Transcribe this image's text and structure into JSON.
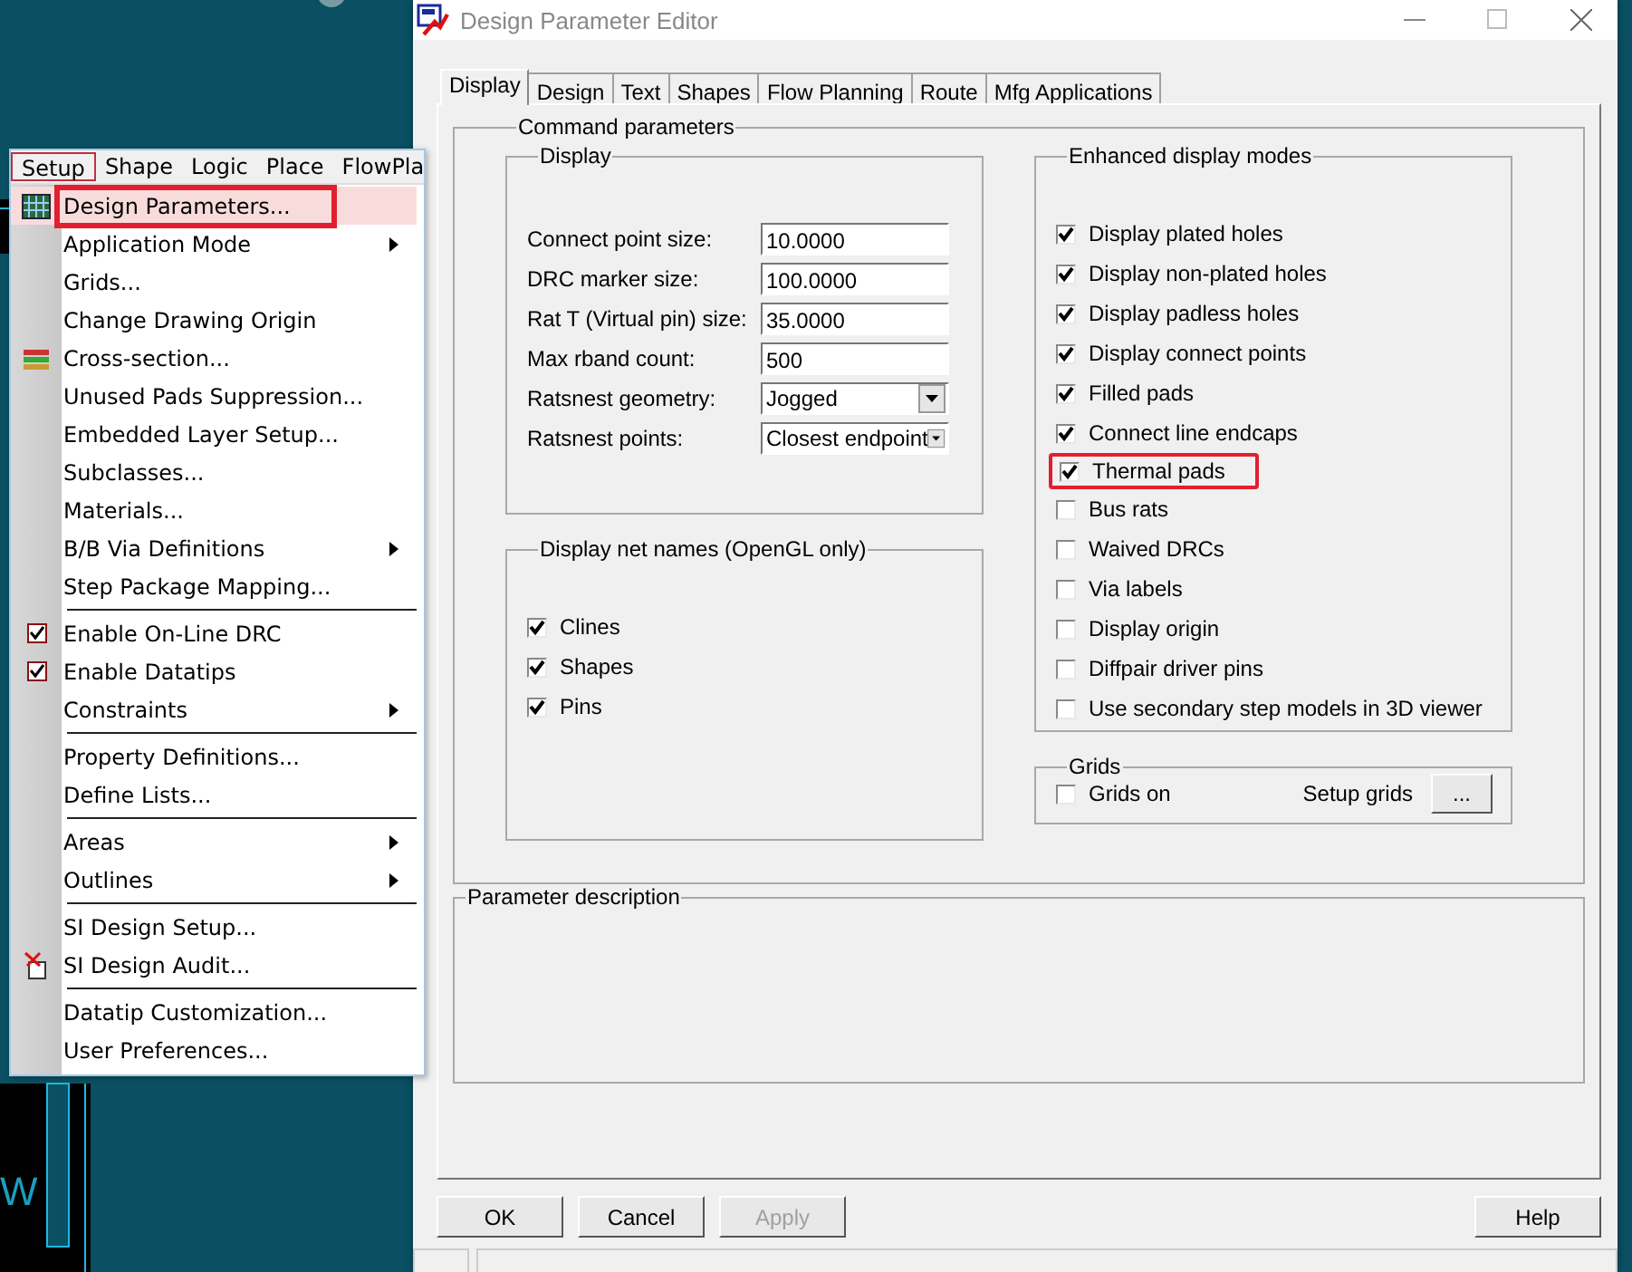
{
  "canvas": {
    "label": "W"
  },
  "menu": {
    "bar": [
      {
        "label": "Setup",
        "selected": true
      },
      {
        "label": "Shape",
        "selected": false
      },
      {
        "label": "Logic",
        "selected": false
      },
      {
        "label": "Place",
        "selected": false
      },
      {
        "label": "FlowPla",
        "selected": false
      }
    ],
    "items": [
      {
        "kind": "icon",
        "label": "Design Parameters...",
        "submenu": false,
        "highlighted": true,
        "annotated": true
      },
      {
        "kind": "plain",
        "label": "Application Mode",
        "submenu": true,
        "highlighted": false,
        "annotated": false
      },
      {
        "kind": "plain",
        "label": "Grids...",
        "submenu": false,
        "highlighted": false,
        "annotated": false
      },
      {
        "kind": "plain",
        "label": "Change Drawing Origin",
        "submenu": false,
        "highlighted": false,
        "annotated": false
      },
      {
        "kind": "icon",
        "label": "Cross-section...",
        "submenu": false,
        "highlighted": false,
        "annotated": false
      },
      {
        "kind": "plain",
        "label": "Unused Pads Suppression...",
        "submenu": false,
        "highlighted": false,
        "annotated": false
      },
      {
        "kind": "plain",
        "label": "Embedded Layer Setup...",
        "submenu": false,
        "highlighted": false,
        "annotated": false
      },
      {
        "kind": "plain",
        "label": "Subclasses...",
        "submenu": false,
        "highlighted": false,
        "annotated": false
      },
      {
        "kind": "plain",
        "label": "Materials...",
        "submenu": false,
        "highlighted": false,
        "annotated": false
      },
      {
        "kind": "plain",
        "label": "B/B Via Definitions",
        "submenu": true,
        "highlighted": false,
        "annotated": false
      },
      {
        "kind": "plain",
        "label": "Step Package Mapping...",
        "submenu": false,
        "highlighted": false,
        "annotated": false
      },
      {
        "kind": "separator"
      },
      {
        "kind": "check",
        "label": "Enable On-Line DRC",
        "checked": true,
        "submenu": false,
        "highlighted": false,
        "annotated": false
      },
      {
        "kind": "check",
        "label": "Enable Datatips",
        "checked": true,
        "submenu": false,
        "highlighted": false,
        "annotated": false
      },
      {
        "kind": "plain",
        "label": "Constraints",
        "submenu": true,
        "highlighted": false,
        "annotated": false
      },
      {
        "kind": "separator"
      },
      {
        "kind": "plain",
        "label": "Property Definitions...",
        "submenu": false,
        "highlighted": false,
        "annotated": false
      },
      {
        "kind": "plain",
        "label": "Define Lists...",
        "submenu": false,
        "highlighted": false,
        "annotated": false
      },
      {
        "kind": "separator"
      },
      {
        "kind": "plain",
        "label": "Areas",
        "submenu": true,
        "highlighted": false,
        "annotated": false
      },
      {
        "kind": "plain",
        "label": "Outlines",
        "submenu": true,
        "highlighted": false,
        "annotated": false
      },
      {
        "kind": "separator"
      },
      {
        "kind": "plain",
        "label": "SI Design Setup...",
        "submenu": false,
        "highlighted": false,
        "annotated": false
      },
      {
        "kind": "icon",
        "label": "SI Design Audit...",
        "submenu": false,
        "highlighted": false,
        "annotated": false
      },
      {
        "kind": "separator"
      },
      {
        "kind": "plain",
        "label": "Datatip Customization...",
        "submenu": false,
        "highlighted": false,
        "annotated": false
      },
      {
        "kind": "plain",
        "label": "User Preferences...",
        "submenu": false,
        "highlighted": false,
        "annotated": false
      }
    ]
  },
  "window": {
    "title": "Design Parameter Editor"
  },
  "tabs": [
    {
      "label": "Display",
      "selected": true
    },
    {
      "label": "Design",
      "selected": false
    },
    {
      "label": "Text",
      "selected": false
    },
    {
      "label": "Shapes",
      "selected": false
    },
    {
      "label": "Flow Planning",
      "selected": false
    },
    {
      "label": "Route",
      "selected": false
    },
    {
      "label": "Mfg Applications",
      "selected": false
    }
  ],
  "command_parameters": {
    "title": "Command parameters",
    "display": {
      "title": "Display",
      "fields": [
        {
          "kind": "text",
          "label": "Connect point size:",
          "value": "10.0000"
        },
        {
          "kind": "text",
          "label": "DRC marker size:",
          "value": "100.0000"
        },
        {
          "kind": "text",
          "label": "Rat T (Virtual pin) size:",
          "value": "35.0000"
        },
        {
          "kind": "text",
          "label": "Max rband count:",
          "value": "500"
        },
        {
          "kind": "dropdown",
          "label": "Ratsnest geometry:",
          "value": "Jogged"
        },
        {
          "kind": "dropdown",
          "label": "Ratsnest points:",
          "value": "Closest endpoint"
        }
      ]
    },
    "net_names": {
      "title": "Display net names (OpenGL only)",
      "options": [
        {
          "label": "Clines",
          "checked": true
        },
        {
          "label": "Shapes",
          "checked": true
        },
        {
          "label": "Pins",
          "checked": true
        }
      ]
    },
    "enhanced": {
      "title": "Enhanced display modes",
      "options": [
        {
          "label": "Display plated holes",
          "checked": true,
          "annotated": false
        },
        {
          "label": "Display non-plated holes",
          "checked": true,
          "annotated": false
        },
        {
          "label": "Display padless holes",
          "checked": true,
          "annotated": false
        },
        {
          "label": "Display connect points",
          "checked": true,
          "annotated": false
        },
        {
          "label": "Filled pads",
          "checked": true,
          "annotated": false
        },
        {
          "label": "Connect line endcaps",
          "checked": true,
          "annotated": false
        },
        {
          "label": "Thermal pads",
          "checked": true,
          "annotated": true
        },
        {
          "label": "Bus rats",
          "checked": false,
          "annotated": false
        },
        {
          "label": "Waived DRCs",
          "checked": false,
          "annotated": false
        },
        {
          "label": "Via labels",
          "checked": false,
          "annotated": false
        },
        {
          "label": "Display origin",
          "checked": false,
          "annotated": false
        },
        {
          "label": "Diffpair driver pins",
          "checked": false,
          "annotated": false
        },
        {
          "label": "Use secondary step models in 3D viewer",
          "checked": false,
          "annotated": false
        }
      ]
    },
    "grids": {
      "title": "Grids",
      "option": {
        "label": "Grids on",
        "checked": false
      },
      "setup_label": "Setup grids",
      "setup_button": "..."
    }
  },
  "parameter_description": {
    "title": "Parameter description"
  },
  "buttons": [
    {
      "label": "OK",
      "disabled": false,
      "kind": "left"
    },
    {
      "label": "Cancel",
      "disabled": false,
      "kind": "left"
    },
    {
      "label": "Apply",
      "disabled": true,
      "kind": "left"
    },
    {
      "label": "Help",
      "disabled": false,
      "kind": "right"
    }
  ]
}
